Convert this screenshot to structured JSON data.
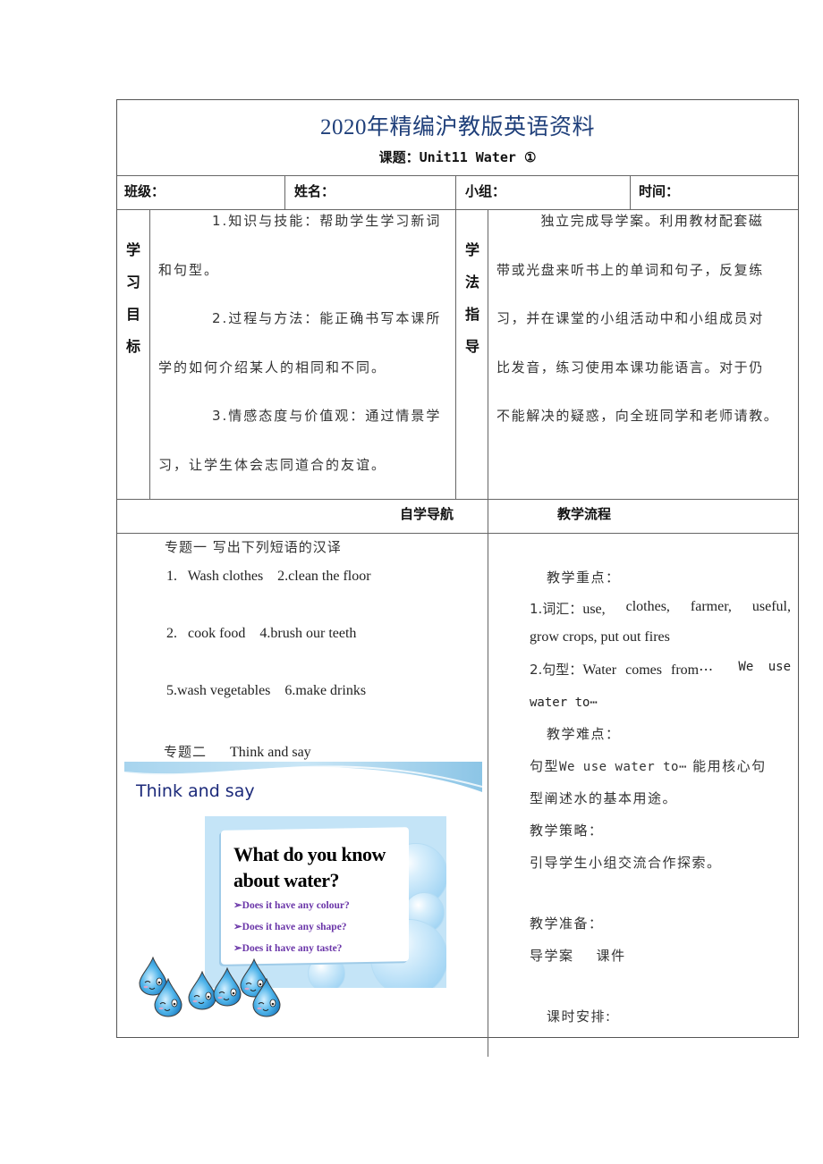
{
  "header": {
    "title": "2020年精编沪教版英语资料",
    "subtitle": "课题：Unit11 Water ①"
  },
  "info_row": {
    "class_label": "班级：",
    "name_label": "姓名：",
    "group_label": "小组：",
    "time_label": "时间："
  },
  "objectives": {
    "side_label": [
      "学",
      "习",
      "目",
      "标"
    ],
    "items": [
      {
        "line1": "1.知识与技能：帮助学生学习新词",
        "line2": "和句型。"
      },
      {
        "line1": "2.过程与方法：能正确书写本课所",
        "line2": "学的如何介绍某人的相同和不同。"
      },
      {
        "line1": "3.情感态度与价值观：通过情景学",
        "line2": "习，让学生体会志同道合的友谊。"
      }
    ]
  },
  "method": {
    "side_label": [
      "学",
      "法",
      "指",
      "导"
    ],
    "lines": [
      "独立完成导学案。利用教材配套磁",
      "带或光盘来听书上的单词和句子，反复练",
      "习，并在课堂的小组活动中和小组成员对",
      "比发音，练习使用本课功能语言。对于仍",
      "不能解决的疑惑，向全班同学和老师请教。"
    ]
  },
  "section_headers": {
    "left": "自学导航",
    "right": "教学流程"
  },
  "self_study": {
    "topic1_title": "专题一  写出下列短语的汉译",
    "phrases": [
      "1.   Wash clothes    2.clean the floor",
      "2.   cook food    4.brush our teeth",
      "5.wash vegetables    6.make drinks"
    ],
    "topic2_label": "专题二",
    "topic2_title": "Think and say",
    "slide": {
      "banner_title": "Think and say",
      "question": "What do you know about water?",
      "question_line1": "What do you know",
      "question_line2": "about water?",
      "bullets": [
        "➢Does it have any colour?",
        "➢Does it have any shape?",
        "➢Does it have any taste?"
      ]
    }
  },
  "teaching": {
    "key_points_label": "教学重点：",
    "vocab_prefix": "1.词汇：",
    "vocab_line1": [
      "use,",
      "clothes,",
      "farmer,",
      "useful,"
    ],
    "vocab_line2": "grow crops, put out fires",
    "pattern_prefix": "2.句型：",
    "pattern_line1_serif": "Water comes from⋯",
    "pattern_line1_mono": "We use",
    "pattern_line2": "water to⋯",
    "difficulty_label": "教学难点：",
    "difficulty_line1_a": "句型",
    "difficulty_line1_b": "We use water to⋯",
    "difficulty_line1_c": "能用核心句",
    "difficulty_line2": "型阐述水的基本用途。",
    "strategy_label": "教学策略：",
    "strategy_text": "引导学生小组交流合作探索。",
    "prep_label": "教学准备：",
    "prep_text": "导学案    课件",
    "schedule_label": "课时安排:"
  }
}
